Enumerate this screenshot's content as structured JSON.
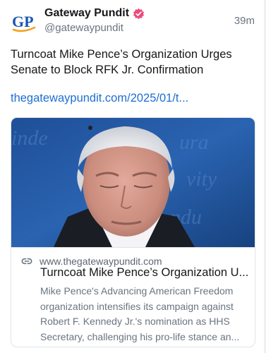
{
  "post": {
    "author_name": "Gateway Pundit",
    "handle": "@gatewaypundit",
    "time": "39m",
    "text": "Turncoat Mike Pence’s Organization Urges Senate to Block RFK Jr. Confirmation",
    "link_text": "thegatewaypundit.com/2025/01/t...",
    "avatar_logo_text": "GP",
    "verified_icon": "verified-badge-icon"
  },
  "card": {
    "domain": "www.thegatewaypundit.com",
    "title": "Turncoat Mike Pence’s Organization U...",
    "description": "Mike Pence's Advancing American Freedom organization intensifies its campaign against Robert F. Kennedy Jr.'s nomination as HHS Secretary, challenging his pro-life stance an...",
    "link_icon": "link-icon"
  },
  "colors": {
    "brand_blue": "#1a58b4",
    "brand_orange": "#f0a21d",
    "verified_pink": "#ee4a7c",
    "link_blue": "#1f6fd1",
    "muted_text": "#6b7480"
  }
}
